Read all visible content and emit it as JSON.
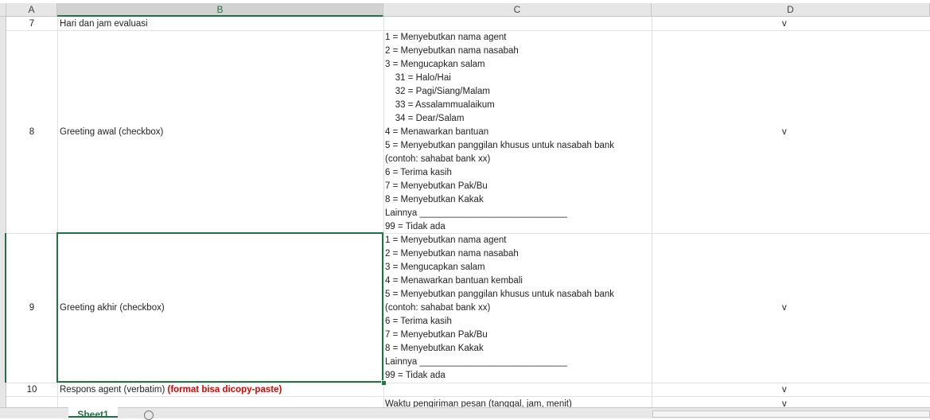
{
  "columns": [
    "A",
    "B",
    "C",
    "D"
  ],
  "rows": [
    {
      "num": "7",
      "b": "Hari dan jam evaluasi",
      "d": "v"
    },
    {
      "num": "8",
      "b": "Greeting awal (checkbox)",
      "d": "v",
      "c_lines": [
        "1 = Menyebutkan nama agent",
        "2 = Menyebutkan nama nasabah",
        "3 = Mengucapkan salam",
        "    31 = Halo/Hai",
        "    32 = Pagi/Siang/Malam",
        "    33 = Assalammualaikum",
        "    34 = Dear/Salam",
        "4 = Menawarkan bantuan",
        "5 = Menyebutkan panggilan khusus untuk nasabah bank",
        "(contoh: sahabat bank xx)",
        "6 = Terima kasih",
        "7 = Menyebutkan Pak/Bu",
        "8 = Menyebutkan Kakak",
        "Lainnya _____________________________",
        "99 = Tidak ada"
      ]
    },
    {
      "num": "9",
      "b": "Greeting akhir (checkbox)",
      "d": "v",
      "c_lines": [
        "1 = Menyebutkan nama agent",
        "2 = Menyebutkan nama nasabah",
        "3 = Mengucapkan salam",
        "4 = Menawarkan bantuan kembali",
        "5 = Menyebutkan panggilan khusus untuk nasabah bank",
        "(contoh: sahabat bank xx)",
        "6 = Terima kasih",
        "7 = Menyebutkan Pak/Bu",
        "8 = Menyebutkan Kakak",
        "Lainnya _____________________________",
        "99 = Tidak ada"
      ]
    },
    {
      "num": "10",
      "b": "Respons agent (verbatim)",
      "b_note": "(format bisa dicopy-paste)",
      "d": "v"
    },
    {
      "c": "Waktu pengiriman pesan (tanggal, jam, menit)",
      "d": "v"
    }
  ],
  "sheet_tab": "Sheet1",
  "colors": {
    "selection": "#217346",
    "note": "#e00000",
    "header_bg": "#e6e6e6"
  }
}
